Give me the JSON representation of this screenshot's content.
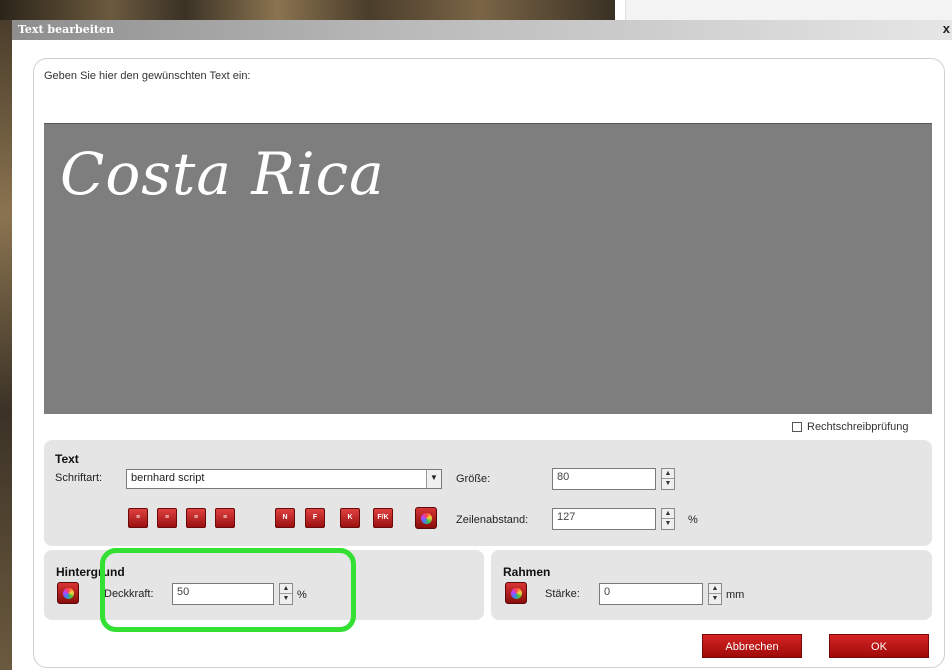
{
  "window": {
    "title": "Text bearbeiten",
    "close_glyph": "x"
  },
  "prompt": "Geben Sie hier den gewünschten Text ein:",
  "preview": {
    "text": "Costa Rica",
    "bg_color": "#7e7e7e",
    "text_color": "#ffffff"
  },
  "spellcheck": {
    "label": "Rechtschreibprüfung",
    "checked": false
  },
  "text_panel": {
    "heading": "Text",
    "font_label": "Schriftart:",
    "font_value": "bernhard script",
    "size_label": "Größe:",
    "size_value": "80",
    "line_spacing_label": "Zeilenabstand:",
    "line_spacing_value": "127",
    "line_spacing_unit": "%",
    "align_buttons": [
      "align-left-icon",
      "align-center-icon",
      "align-right-icon",
      "align-justify-icon"
    ],
    "style_buttons": [
      "N",
      "F",
      "K",
      "F/K"
    ]
  },
  "background_panel": {
    "heading": "Hintergrund",
    "opacity_label": "Deckkraft:",
    "opacity_value": "50",
    "opacity_unit": "%"
  },
  "frame_panel": {
    "heading": "Rahmen",
    "thickness_label": "Stärke:",
    "thickness_value": "0",
    "thickness_unit": "mm"
  },
  "buttons": {
    "cancel": "Abbrechen",
    "ok": "OK"
  },
  "colors": {
    "accent": "#b01010",
    "highlight": "#33e033",
    "panel": "#e5e5e5"
  }
}
